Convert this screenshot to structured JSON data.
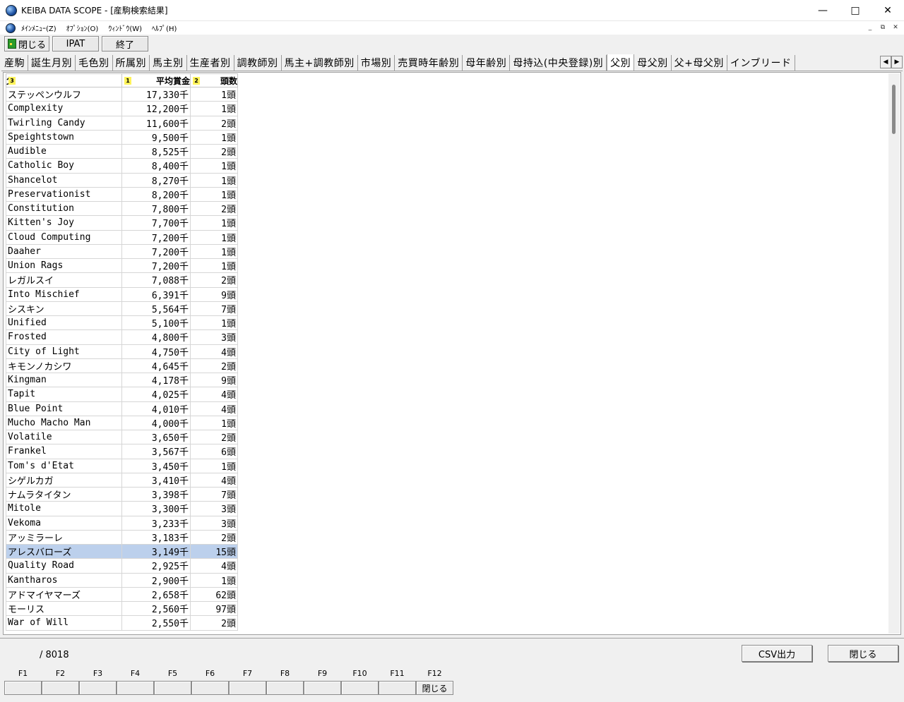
{
  "window": {
    "title": "KEIBA DATA SCOPE - [産駒検索結果]"
  },
  "menu": [
    {
      "label": "ﾒｲﾝﾒﾆｭｰ(Z)"
    },
    {
      "label": "ｵﾌﾟｼｮﾝ(O)"
    },
    {
      "label": "ｳｨﾝﾄﾞｳ(W)"
    },
    {
      "label": "ﾍﾙﾌﾟ(H)"
    }
  ],
  "toolbar": {
    "close_label": "閉じる",
    "ipat_label": "IPAT",
    "exit_label": "終了"
  },
  "tabs": [
    {
      "label": "産駒"
    },
    {
      "label": "誕生月別"
    },
    {
      "label": "毛色別"
    },
    {
      "label": "所属別"
    },
    {
      "label": "馬主別"
    },
    {
      "label": "生産者別"
    },
    {
      "label": "調教師別"
    },
    {
      "label": "馬主+調教師別"
    },
    {
      "label": "市場別"
    },
    {
      "label": "売買時年齢別"
    },
    {
      "label": "母年齢別"
    },
    {
      "label": "母持込(中央登録)別"
    },
    {
      "label": "父別"
    },
    {
      "label": "母父別"
    },
    {
      "label": "父+母父別"
    },
    {
      "label": "インブリード"
    }
  ],
  "active_tab": "父別",
  "table": {
    "headers": {
      "name": {
        "label": "父",
        "sort": "3"
      },
      "avg": {
        "label": "平均賞金",
        "sort": "1"
      },
      "count": {
        "label": "頭数",
        "sort": "2"
      }
    },
    "rows": [
      {
        "name": "ステッペンウルフ",
        "avg": "17,330千",
        "count": "1頭"
      },
      {
        "name": "Complexity",
        "avg": "12,200千",
        "count": "1頭"
      },
      {
        "name": "Twirling Candy",
        "avg": "11,600千",
        "count": "2頭"
      },
      {
        "name": "Speightstown",
        "avg": "9,500千",
        "count": "1頭"
      },
      {
        "name": "Audible",
        "avg": "8,525千",
        "count": "2頭"
      },
      {
        "name": "Catholic Boy",
        "avg": "8,400千",
        "count": "1頭"
      },
      {
        "name": "Shancelot",
        "avg": "8,270千",
        "count": "1頭"
      },
      {
        "name": "Preservationist",
        "avg": "8,200千",
        "count": "1頭"
      },
      {
        "name": "Constitution",
        "avg": "7,800千",
        "count": "2頭"
      },
      {
        "name": "Kitten's Joy",
        "avg": "7,700千",
        "count": "1頭"
      },
      {
        "name": "Cloud Computing",
        "avg": "7,200千",
        "count": "1頭"
      },
      {
        "name": "Daaher",
        "avg": "7,200千",
        "count": "1頭"
      },
      {
        "name": "Union Rags",
        "avg": "7,200千",
        "count": "1頭"
      },
      {
        "name": "レガルスイ",
        "avg": "7,088千",
        "count": "2頭"
      },
      {
        "name": "Into Mischief",
        "avg": "6,391千",
        "count": "9頭"
      },
      {
        "name": "シスキン",
        "avg": "5,564千",
        "count": "7頭"
      },
      {
        "name": "Unified",
        "avg": "5,100千",
        "count": "1頭"
      },
      {
        "name": "Frosted",
        "avg": "4,800千",
        "count": "3頭"
      },
      {
        "name": "City of Light",
        "avg": "4,750千",
        "count": "4頭"
      },
      {
        "name": "キモンノカシワ",
        "avg": "4,645千",
        "count": "2頭"
      },
      {
        "name": "Kingman",
        "avg": "4,178千",
        "count": "9頭"
      },
      {
        "name": "Tapit",
        "avg": "4,025千",
        "count": "4頭"
      },
      {
        "name": "Blue Point",
        "avg": "4,010千",
        "count": "4頭"
      },
      {
        "name": "Mucho Macho Man",
        "avg": "4,000千",
        "count": "1頭"
      },
      {
        "name": "Volatile",
        "avg": "3,650千",
        "count": "2頭"
      },
      {
        "name": "Frankel",
        "avg": "3,567千",
        "count": "6頭"
      },
      {
        "name": "Tom's d'Etat",
        "avg": "3,450千",
        "count": "1頭"
      },
      {
        "name": "シゲルカガ",
        "avg": "3,410千",
        "count": "4頭"
      },
      {
        "name": "ナムラタイタン",
        "avg": "3,398千",
        "count": "7頭"
      },
      {
        "name": "Mitole",
        "avg": "3,300千",
        "count": "3頭"
      },
      {
        "name": "Vekoma",
        "avg": "3,233千",
        "count": "3頭"
      },
      {
        "name": "アッミラーレ",
        "avg": "3,183千",
        "count": "2頭"
      },
      {
        "name": "アレスバローズ",
        "avg": "3,149千",
        "count": "15頭",
        "selected": true
      },
      {
        "name": "Quality Road",
        "avg": "2,925千",
        "count": "4頭"
      },
      {
        "name": "Kantharos",
        "avg": "2,900千",
        "count": "1頭"
      },
      {
        "name": "アドマイヤマーズ",
        "avg": "2,658千",
        "count": "62頭"
      },
      {
        "name": "モーリス",
        "avg": "2,560千",
        "count": "97頭"
      },
      {
        "name": "War of Will",
        "avg": "2,550千",
        "count": "2頭"
      }
    ]
  },
  "status": {
    "record_text": "/    8018",
    "csv_label": "CSV出力",
    "close_label": "閉じる"
  },
  "fkeys": [
    {
      "key": "F1",
      "label": ""
    },
    {
      "key": "F2",
      "label": ""
    },
    {
      "key": "F3",
      "label": ""
    },
    {
      "key": "F4",
      "label": ""
    },
    {
      "key": "F5",
      "label": ""
    },
    {
      "key": "F6",
      "label": ""
    },
    {
      "key": "F7",
      "label": ""
    },
    {
      "key": "F8",
      "label": ""
    },
    {
      "key": "F9",
      "label": ""
    },
    {
      "key": "F10",
      "label": ""
    },
    {
      "key": "F11",
      "label": ""
    },
    {
      "key": "F12",
      "label": "閉じる"
    }
  ],
  "colors": {
    "selected_row": "#bcd0ec",
    "sort_badge": "#fff35a"
  }
}
